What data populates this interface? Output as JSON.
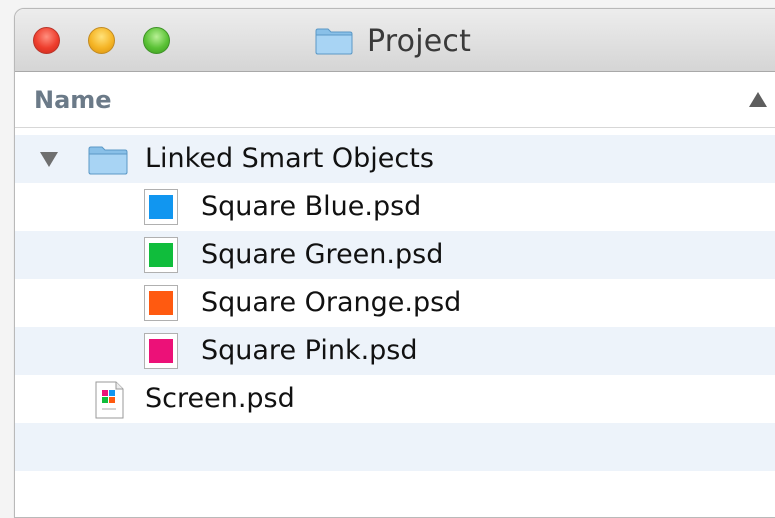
{
  "window": {
    "title": "Project",
    "traffic_lights": {
      "close_color": "#ee3e2d",
      "minimize_color": "#f5b526",
      "zoom_color": "#5bc236"
    }
  },
  "header": {
    "column_name": "Name",
    "sort_indicator": "ascending-arrow-icon"
  },
  "files": [
    {
      "name": "Linked Smart Objects",
      "type": "folder",
      "expanded": true,
      "icon": "folder-icon",
      "children": [
        {
          "name": "Square Blue.psd",
          "type": "psd",
          "icon": "psd-thumbnail-icon",
          "color": "#1196f0"
        },
        {
          "name": "Square Green.psd",
          "type": "psd",
          "icon": "psd-thumbnail-icon",
          "color": "#10bd3c"
        },
        {
          "name": "Square Orange.psd",
          "type": "psd",
          "icon": "psd-thumbnail-icon",
          "color": "#ff5a10"
        },
        {
          "name": "Square Pink.psd",
          "type": "psd",
          "icon": "psd-thumbnail-icon",
          "color": "#ec1178"
        }
      ]
    },
    {
      "name": "Screen.psd",
      "type": "psd",
      "icon": "document-icon"
    }
  ]
}
